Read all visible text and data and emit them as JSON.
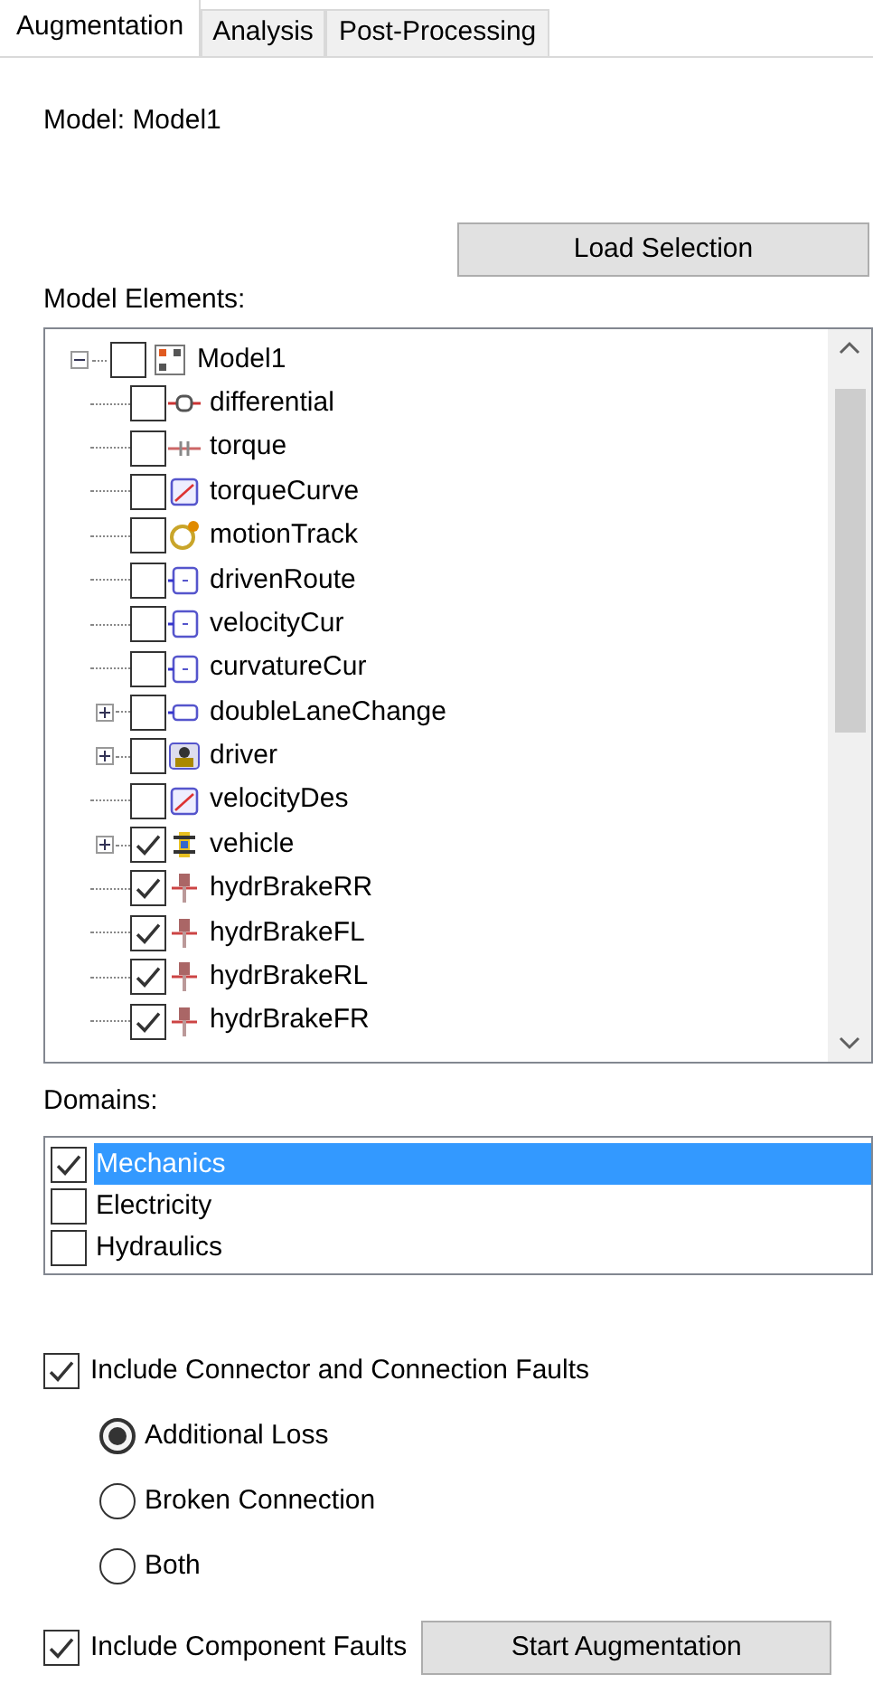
{
  "tabs": [
    {
      "label": "Augmentation",
      "selected": true
    },
    {
      "label": "Analysis",
      "selected": false
    },
    {
      "label": "Post-Processing",
      "selected": false
    }
  ],
  "model_label": "Model: Model1",
  "load_button": "Load Selection",
  "elements_label": "Model Elements:",
  "tree": {
    "label": "Model1",
    "checked": false,
    "expanded": true,
    "children": [
      {
        "label": "differential",
        "kind": "gear",
        "checked": false,
        "collapsed": false
      },
      {
        "label": "torque",
        "kind": "flow",
        "checked": false,
        "collapsed": false
      },
      {
        "label": "torqueCurve",
        "kind": "curve",
        "checked": false,
        "collapsed": false
      },
      {
        "label": "motionTrack",
        "kind": "track",
        "checked": false,
        "collapsed": false
      },
      {
        "label": "drivenRoute",
        "kind": "block",
        "checked": false,
        "collapsed": false
      },
      {
        "label": "velocityCur",
        "kind": "block",
        "checked": false,
        "collapsed": false
      },
      {
        "label": "curvatureCur",
        "kind": "block",
        "checked": false,
        "collapsed": false
      },
      {
        "label": "doubleLaneChange",
        "kind": "lane",
        "checked": false,
        "collapsed": true
      },
      {
        "label": "driver",
        "kind": "driver",
        "checked": false,
        "collapsed": true
      },
      {
        "label": "velocityDes",
        "kind": "curve",
        "checked": false,
        "collapsed": false
      },
      {
        "label": "vehicle",
        "kind": "vehicle",
        "checked": true,
        "collapsed": true
      },
      {
        "label": "hydrBrakeRR",
        "kind": "brake",
        "checked": true,
        "collapsed": false
      },
      {
        "label": "hydrBrakeFL",
        "kind": "brake",
        "checked": true,
        "collapsed": false
      },
      {
        "label": "hydrBrakeRL",
        "kind": "brake",
        "checked": true,
        "collapsed": false
      },
      {
        "label": "hydrBrakeFR",
        "kind": "brake",
        "checked": true,
        "collapsed": false
      }
    ]
  },
  "domains_label": "Domains:",
  "domains": [
    {
      "label": "Mechanics",
      "checked": true,
      "selected": true
    },
    {
      "label": "Electricity",
      "checked": false,
      "selected": false
    },
    {
      "label": "Hydraulics",
      "checked": false,
      "selected": false
    }
  ],
  "connector_faults": {
    "label": "Include Connector and Connection Faults",
    "checked": true
  },
  "fault_modes": [
    {
      "label": "Additional Loss",
      "selected": true
    },
    {
      "label": "Broken Connection",
      "selected": false
    },
    {
      "label": "Both",
      "selected": false
    }
  ],
  "component_faults": {
    "label": "Include Component Faults",
    "checked": true
  },
  "start_button": "Start Augmentation"
}
